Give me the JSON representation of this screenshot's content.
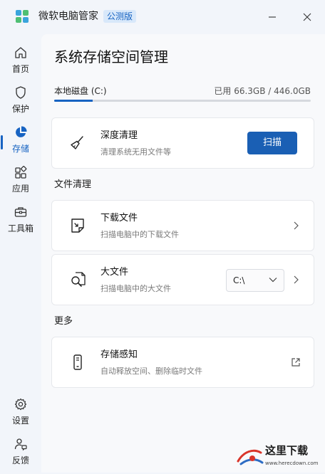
{
  "app": {
    "name": "微软电脑管家",
    "badge": "公测版"
  },
  "sidebar": {
    "items": [
      {
        "label": "首页",
        "icon": "home-icon"
      },
      {
        "label": "保护",
        "icon": "shield-icon"
      },
      {
        "label": "存储",
        "icon": "pie-chart-icon",
        "active": true
      },
      {
        "label": "应用",
        "icon": "apps-icon"
      },
      {
        "label": "工具箱",
        "icon": "toolbox-icon"
      }
    ],
    "bottom": [
      {
        "label": "设置",
        "icon": "gear-icon"
      },
      {
        "label": "反馈",
        "icon": "feedback-icon"
      }
    ]
  },
  "main": {
    "title": "系统存储空间管理",
    "disk": {
      "name": "本地磁盘 (C:)",
      "usage": "已用 66.3GB / 446.0GB",
      "used_fraction": 0.149
    },
    "deep_clean": {
      "title": "深度清理",
      "subtitle": "清理系统无用文件等",
      "button": "扫描"
    },
    "file_section": "文件清理",
    "downloads": {
      "title": "下载文件",
      "subtitle": "扫描电脑中的下载文件"
    },
    "large_files": {
      "title": "大文件",
      "subtitle": "扫描电脑中的大文件",
      "drive": "C:\\"
    },
    "more_section": "更多",
    "storage_sense": {
      "title": "存储感知",
      "subtitle": "自动释放空间、删除临时文件"
    }
  },
  "watermark": {
    "text": "这里下载",
    "url": "www.herecdown.com"
  },
  "colors": {
    "accent": "#1763c2",
    "button": "#1a5fb4",
    "background": "#f2f5fa"
  }
}
